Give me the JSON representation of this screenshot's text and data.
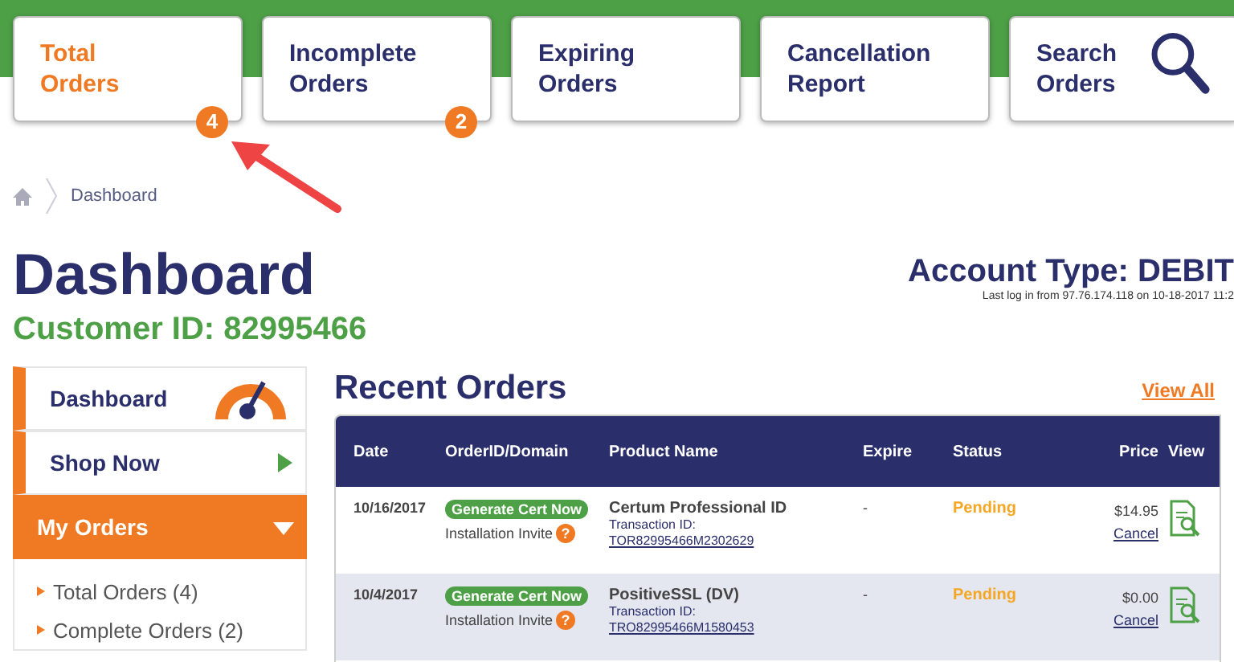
{
  "tabs": [
    {
      "label": "Total Orders",
      "kind": "count",
      "selected": true,
      "badge": "4"
    },
    {
      "label": "Incomplete Orders",
      "kind": "count",
      "selected": false,
      "badge": "2"
    },
    {
      "label": "Expiring Orders",
      "kind": "plain",
      "selected": false
    },
    {
      "label": "Cancellation Report",
      "kind": "plain",
      "selected": false
    },
    {
      "label": "Search Orders",
      "kind": "search",
      "selected": false
    }
  ],
  "breadcrumb": [
    "Dashboard"
  ],
  "header": {
    "title": "Dashboard",
    "customer_id": "Customer ID: 82995466",
    "account_type": "Account Type: DEBIT",
    "last_login": "Last log in from 97.76.174.118 on 10-18-2017 11:2"
  },
  "sidebar": {
    "items": [
      {
        "label": "Dashboard",
        "kind": "gauge",
        "selected": false
      },
      {
        "label": "Shop Now",
        "kind": "link",
        "selected": false
      },
      {
        "label": "My Orders",
        "kind": "menu",
        "selected": true,
        "expanded": true,
        "children": [
          {
            "label": "Total Orders (4)"
          },
          {
            "label": "Complete Orders (2)"
          }
        ]
      }
    ]
  },
  "recent_orders": {
    "title": "Recent Orders",
    "view_all": "View All",
    "columns": [
      "Date",
      "OrderID/Domain",
      "Product Name",
      "Expire",
      "Status",
      "Price",
      "View"
    ],
    "rows": [
      {
        "date": "10/16/2017",
        "action": "Generate Cert Now",
        "invite": "Installation Invite",
        "help": "?",
        "product": "Certum Professional ID",
        "transaction_label": "Transaction ID:",
        "transaction_id": "TOR82995466M2302629",
        "expire": "-",
        "status": "Pending",
        "price": "$14.95",
        "cancel": "Cancel"
      },
      {
        "date": "10/4/2017",
        "action": "Generate Cert Now",
        "invite": "Installation Invite",
        "help": "?",
        "product": "PositiveSSL (DV)",
        "transaction_label": "Transaction ID:",
        "transaction_id": "TRO82995466M1580453",
        "expire": "-",
        "status": "Pending",
        "price": "$0.00",
        "cancel": "Cancel"
      }
    ]
  }
}
